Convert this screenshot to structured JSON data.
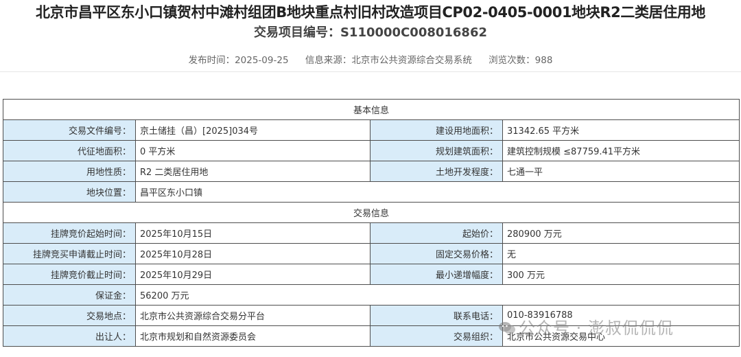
{
  "header": {
    "title": "北京市昌平区东小口镇贺村中滩村组团B地块重点村旧村改造项目CP02-0405-0001地块R2二类居住用地",
    "subtitle": "交易项目编号：S110000C008016862",
    "publish_time": "发布时间：2025-09-25",
    "source": "信息来源：北京市公共资源综合交易系统",
    "views": "浏览次数：988"
  },
  "basic": {
    "section_title": "基本信息",
    "rows": [
      [
        "交易文件编号：",
        "京土储挂（昌）[2025]034号",
        "建设用地面积：",
        "31342.65 平方米"
      ],
      [
        "代征地面积：",
        "0 平方米",
        "规划建筑面积：",
        "建筑控制规模 ≤87759.41平方米"
      ],
      [
        "用地性质：",
        "R2 二类居住用地",
        "土地开发程度：",
        "七通一平"
      ],
      [
        "地块位置：",
        "昌平区东小口镇"
      ]
    ]
  },
  "trade": {
    "section_title": "交易信息",
    "rows": [
      [
        "挂牌竞价起始时间：",
        "2025年10月15日",
        "起始价：",
        "280900 万元"
      ],
      [
        "挂牌竞买申请截止时间：",
        "2025年10月28日",
        "固定交易价格：",
        "无"
      ],
      [
        "挂牌竞价截止时间：",
        "2025年10月29日",
        "最小递增幅度：",
        "300 万元"
      ],
      [
        "保证金：",
        "56200 万元"
      ],
      [
        "交易地点：",
        "北京市公共资源综合交易分平台",
        "联系电话：",
        "010-83916788"
      ],
      [
        "出让人：",
        "北京市规划和自然资源委员会",
        "交易组织：",
        "北京市公共资源交易中心"
      ]
    ]
  },
  "watermark": {
    "text": "公众号 · 澎叔侃侃侃",
    "icon": "wechat-icon"
  }
}
